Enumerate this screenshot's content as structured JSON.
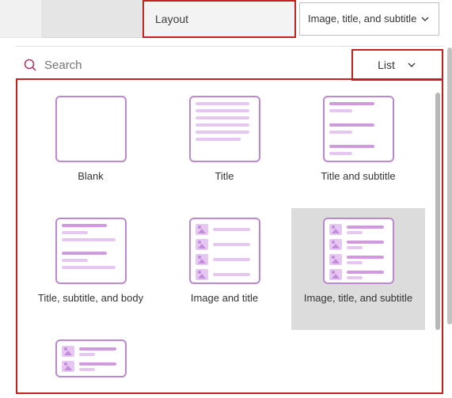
{
  "header": {
    "layout_label": "Layout",
    "selected_value": "Image, title, and subtitle"
  },
  "search": {
    "placeholder": "Search",
    "view_toggle": "List"
  },
  "layouts": [
    {
      "name": "Blank"
    },
    {
      "name": "Title"
    },
    {
      "name": "Title and subtitle"
    },
    {
      "name": "Title, subtitle, and body"
    },
    {
      "name": "Image and title"
    },
    {
      "name": "Image, title, and subtitle",
      "selected": true
    }
  ],
  "colors": {
    "highlight": "#c62121",
    "preview_border": "#bc88cf",
    "preview_line_light": "#e6c7f1",
    "preview_line_dark": "#d19adf"
  }
}
